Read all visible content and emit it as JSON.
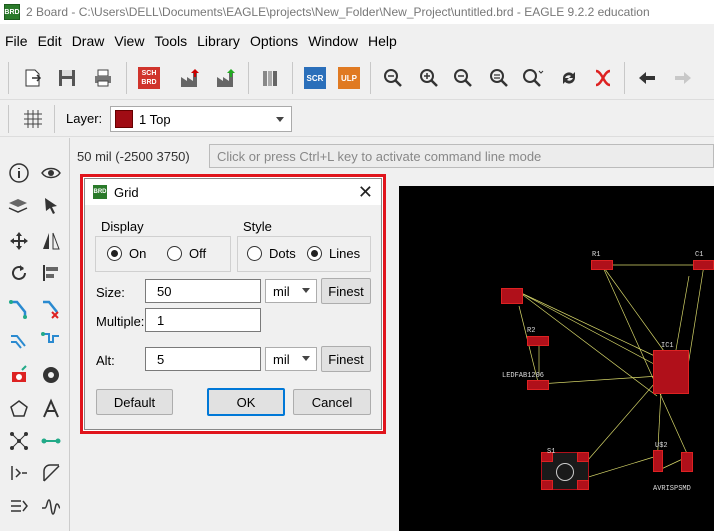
{
  "window": {
    "title": "2 Board - C:\\Users\\DELL\\Documents\\EAGLE\\projects\\New_Folder\\New_Project\\untitled.brd - EAGLE 9.2.2 education",
    "app_icon_label": "BRD"
  },
  "menu": [
    "File",
    "Edit",
    "Draw",
    "View",
    "Tools",
    "Library",
    "Options",
    "Window",
    "Help"
  ],
  "toolbar": {
    "sch_label": "SCH\nBRD",
    "scr_label": "SCR",
    "ulp_label": "ULP"
  },
  "layer_bar": {
    "label": "Layer:",
    "selected": "1 Top",
    "selected_color": "#a00c14"
  },
  "coord_readout": "50 mil (-2500 3750)",
  "command_line": {
    "placeholder": "Click or press Ctrl+L key to activate command line mode"
  },
  "grid_dialog": {
    "title": "Grid",
    "icon_label": "BRD",
    "display_label": "Display",
    "display_on": "On",
    "display_off": "Off",
    "display_value": "On",
    "style_label": "Style",
    "style_dots": "Dots",
    "style_lines": "Lines",
    "style_value": "Lines",
    "size_label": "Size:",
    "size_value": "50",
    "size_unit": "mil",
    "finest_label": "Finest",
    "multiple_label": "Multiple:",
    "multiple_value": "1",
    "alt_label": "Alt:",
    "alt_value": "5",
    "alt_unit": "mil",
    "alt_finest_label": "Finest",
    "default_button": "Default",
    "ok_button": "OK",
    "cancel_button": "Cancel"
  },
  "board_labels": {
    "r1": "R1",
    "c1": "C1",
    "r2": "R2",
    "ledfab": "LEDFAB1206",
    "ic1": "IC1",
    "s1": "S1",
    "u": "U$2",
    "avrisp": "AVRISPSMD"
  },
  "colors": {
    "highlight": "#e0141c",
    "board_bg": "#000000",
    "pad": "#b0101a",
    "airwire": "#d8d86a"
  }
}
